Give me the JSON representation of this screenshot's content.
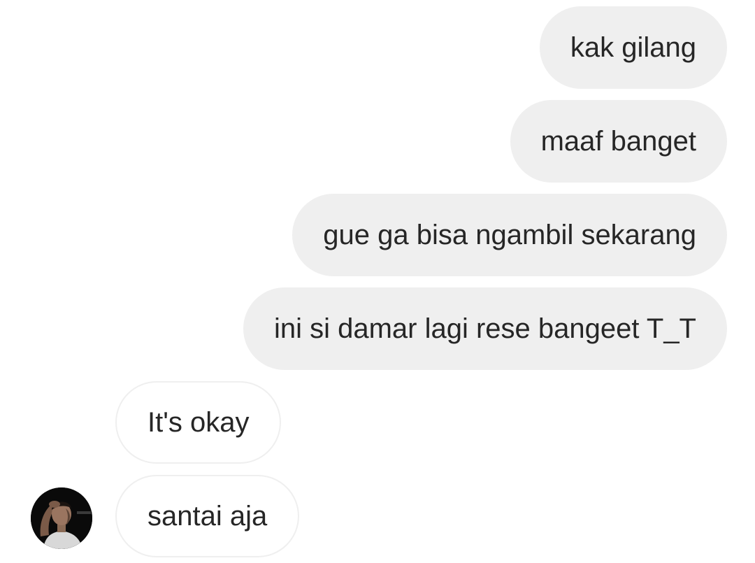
{
  "conversation": {
    "messages": [
      {
        "sender": "me",
        "text": "kak gilang"
      },
      {
        "sender": "me",
        "text": "maaf banget"
      },
      {
        "sender": "me",
        "text": "gue ga bisa ngambil sekarang"
      },
      {
        "sender": "me",
        "text": "ini si damar lagi rese bangeet T_T"
      },
      {
        "sender": "other",
        "text": "It's okay"
      },
      {
        "sender": "other",
        "text": "santai aja"
      }
    ]
  },
  "colors": {
    "outgoing_bubble": "#efefef",
    "incoming_bubble_border": "#efefef",
    "text": "#262626",
    "background": "#ffffff"
  },
  "avatar": {
    "icon": "user-avatar-photo"
  }
}
